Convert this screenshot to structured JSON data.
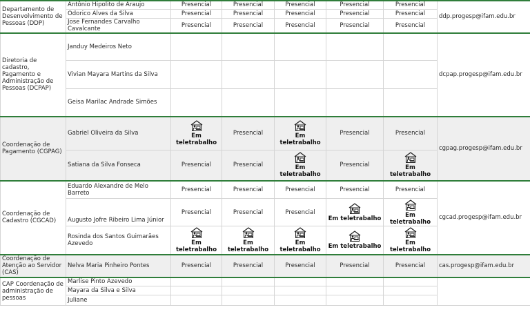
{
  "status_labels": {
    "presencial": "Presencial",
    "teletrabalho": "Em teletrabalho"
  },
  "groups": [
    {
      "department": "Departamento de Desenvolvimento de Pessoas (DDP)",
      "email": "ddp.progesp@ifam.edu.br",
      "rows": [
        {
          "name": "Antônio Hipolito de Araujo",
          "days": [
            "Presencial",
            "Presencial",
            "Presencial",
            "Presencial",
            "Presencial"
          ]
        },
        {
          "name": "Odorico Alves da Silva",
          "days": [
            "Presencial",
            "Presencial",
            "Presencial",
            "Presencial",
            "Presencial"
          ]
        },
        {
          "name": "Jose Fernandes Carvalho Cavalcante",
          "days": [
            "Presencial",
            "Presencial",
            "Presencial",
            "Presencial",
            "Presencial"
          ]
        }
      ]
    },
    {
      "department": "Diretoria de cadastro, Pagamento e Administração de Pessoas (DCPAP)",
      "email": "dcpap.progesp@ifam.edu.br",
      "rows": [
        {
          "name": "Janduy Medeiros Neto",
          "days": [
            "",
            "",
            "",
            "",
            ""
          ]
        },
        {
          "name": "Vivian Mayara Martins da Silva",
          "days": [
            "",
            "",
            "",
            "",
            ""
          ]
        },
        {
          "name": "Geisa Marilac Andrade Simões",
          "days": [
            "",
            "",
            "",
            "",
            ""
          ]
        }
      ]
    },
    {
      "department": "Coordenação de Pagamento (CGPAG)",
      "email": "cgpag.progesp@ifam.edu.br",
      "rows": [
        {
          "name": "Gabriel Oliveira da Silva",
          "days": [
            "Em teletrabalho",
            "Presencial",
            "Em teletrabalho",
            "Presencial",
            "Presencial"
          ]
        },
        {
          "name": "Satiana da Silva Fonseca",
          "days": [
            "Presencial",
            "Presencial",
            "Em teletrabalho",
            "Presencial",
            "Em teletrabalho"
          ]
        }
      ]
    },
    {
      "department": "Coordenação de Cadastro (CGCAD)",
      "email": "cgcad.progesp@ifam.edu.br",
      "rows": [
        {
          "name": "Eduardo Alexandre de Melo Barreto",
          "days": [
            "Presencial",
            "Presencial",
            "Presencial",
            "Presencial",
            "Presencial"
          ]
        },
        {
          "name": "Augusto Jofre Ribeiro Lima Júnior",
          "days": [
            "Presencial",
            "Presencial",
            "Presencial",
            "Em teletrabalho",
            "Em teletrabalho"
          ]
        },
        {
          "name": "Rosinda dos Santos Guimarães Azevedo",
          "days": [
            "Em teletrabalho",
            "Em teletrabalho",
            "Em teletrabalho",
            "Em teletrabalho",
            "Em teletrabalho"
          ]
        }
      ]
    },
    {
      "department": "Coordenação de Atenção ao Servidor (CAS)",
      "email": "cas.progesp@ifam.edu.br",
      "rows": [
        {
          "name": "Nelva Maria Pinheiro Pontes",
          "days": [
            "Presencial",
            "Presencial",
            "Presencial",
            "Presencial",
            "Presencial"
          ]
        }
      ]
    },
    {
      "department": "CAP Coordenação de administração de pessoas",
      "email": "",
      "rows": [
        {
          "name": "Marlise Pinto Azevedo",
          "days": [
            "",
            "",
            "",
            "",
            ""
          ]
        },
        {
          "name": "Mayara da Silva e Silva",
          "days": [
            "",
            "",
            "",
            "",
            ""
          ]
        },
        {
          "name": "Juliane",
          "days": [
            "",
            "",
            "",
            "",
            ""
          ]
        }
      ]
    }
  ],
  "icons": {
    "teletrabalho": "person-at-computer-icon"
  },
  "colors": {
    "accent_border": "#2f7d3a",
    "shaded_row": "#efefef",
    "grid_line": "#d4d4d4"
  }
}
